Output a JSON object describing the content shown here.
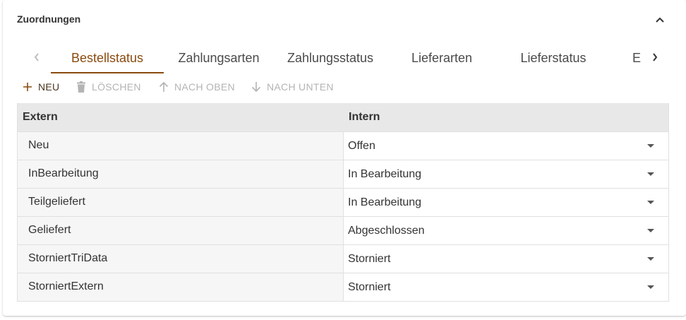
{
  "panel": {
    "title": "Zuordnungen"
  },
  "tabs": [
    {
      "label": "Bestellstatus",
      "active": true
    },
    {
      "label": "Zahlungsarten"
    },
    {
      "label": "Zahlungsstatus"
    },
    {
      "label": "Lieferarten"
    },
    {
      "label": "Lieferstatus"
    },
    {
      "label": "E"
    }
  ],
  "toolbar": {
    "new_label": "NEU",
    "delete_label": "LÖSCHEN",
    "up_label": "NACH OBEN",
    "down_label": "NACH UNTEN"
  },
  "grid": {
    "columns": [
      "Extern",
      "Intern"
    ],
    "rows": [
      {
        "extern": "Neu",
        "intern": "Offen"
      },
      {
        "extern": "InBearbeitung",
        "intern": "In Bearbeitung"
      },
      {
        "extern": "Teilgeliefert",
        "intern": "In Bearbeitung"
      },
      {
        "extern": "Geliefert",
        "intern": "Abgeschlossen"
      },
      {
        "extern": "StorniertTriData",
        "intern": "Storniert"
      },
      {
        "extern": "StorniertExtern",
        "intern": "Storniert"
      }
    ]
  },
  "colors": {
    "accent": "#8a4b0f",
    "disabled": "#b4b4b4",
    "header_bg": "#e8e8e8"
  }
}
